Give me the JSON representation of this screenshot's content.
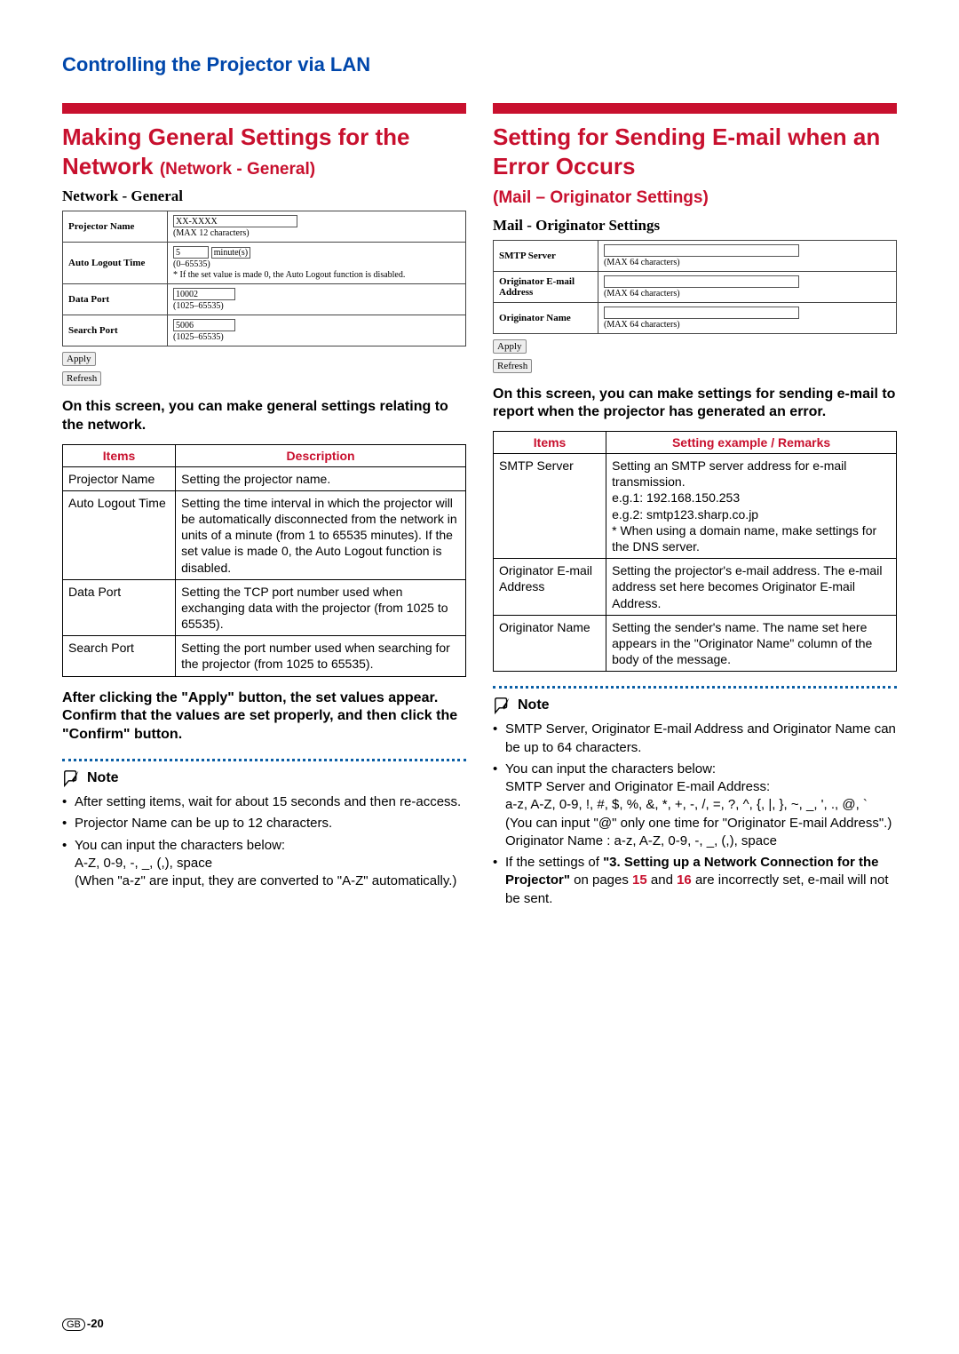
{
  "page_title": "Controlling the Projector via LAN",
  "left": {
    "heading_main": "Making General Settings for the Network ",
    "heading_sub": "(Network - General)",
    "ss_title": "Network - General",
    "form": {
      "projector_name": {
        "label": "Projector Name",
        "value": "XX-XXXX",
        "hint": "(MAX 12 characters)"
      },
      "auto_logout": {
        "label": "Auto Logout Time",
        "value": "5",
        "unit": "minute(s)",
        "hint1": "(0–65535)",
        "hint2": "* If the set value is made 0, the Auto Logout function is disabled."
      },
      "data_port": {
        "label": "Data Port",
        "value": "10002",
        "hint": "(1025–65535)"
      },
      "search_port": {
        "label": "Search Port",
        "value": "5006",
        "hint": "(1025–65535)"
      }
    },
    "apply_btn": "Apply",
    "refresh_btn": "Refresh",
    "intro": "On this screen, you can make general settings relating to the network.",
    "table_headers": {
      "items": "Items",
      "desc": "Description"
    },
    "rows": [
      {
        "item": "Projector Name",
        "desc": "Setting the projector name."
      },
      {
        "item": "Auto Logout Time",
        "desc": "Setting the time interval in which the projector will be automatically disconnected from the network in units of a minute (from 1 to 65535 minutes). If the set value is made 0, the Auto Logout function is disabled."
      },
      {
        "item": "Data Port",
        "desc": "Setting the TCP port number used when exchanging data with the projector (from 1025 to 65535)."
      },
      {
        "item": "Search Port",
        "desc": "Setting the port number used when searching for the projector (from 1025 to 65535)."
      }
    ],
    "after_apply": "After clicking the \"Apply\" button, the set values appear. Confirm that the values are set properly, and then click the \"Confirm\" button.",
    "note_label": "Note",
    "notes": [
      "After setting items, wait for about 15 seconds and then re-access.",
      "Projector Name can be up to 12 characters.",
      "You can input the characters below:\nA-Z, 0-9, -, _, (,), space\n(When \"a-z\" are input, they are converted to \"A-Z\" automatically.)"
    ]
  },
  "right": {
    "heading_main": "Setting for Sending E-mail when an Error Occurs",
    "heading_sub": "(Mail – Originator Settings)",
    "ss_title": "Mail - Originator Settings",
    "form": {
      "smtp": {
        "label": "SMTP Server",
        "hint": "(MAX 64 characters)"
      },
      "oemail": {
        "label": "Originator E-mail Address",
        "hint": "(MAX 64 characters)"
      },
      "oname": {
        "label": "Originator Name",
        "hint": "(MAX 64 characters)"
      }
    },
    "apply_btn": "Apply",
    "refresh_btn": "Refresh",
    "intro": "On this screen, you can make settings for sending e-mail to report when the projector has generated an error.",
    "table_headers": {
      "items": "Items",
      "desc": "Setting example / Remarks"
    },
    "rows": [
      {
        "item": "SMTP Server",
        "desc": "Setting an SMTP server address for e-mail transmission.\ne.g.1: 192.168.150.253\ne.g.2: smtp123.sharp.co.jp\n* When using a domain name, make settings for the DNS server."
      },
      {
        "item": "Originator E-mail Address",
        "desc": "Setting the projector's e-mail address. The e-mail address set here becomes Originator E-mail Address."
      },
      {
        "item": "Originator Name",
        "desc": "Setting the sender's name.  The name set here appears in the \"Originator Name\" column of the body of the message."
      }
    ],
    "note_label": "Note",
    "notes_plain": [
      "SMTP Server, Originator E-mail Address and Originator Name can be up to 64 characters.",
      "You can input the characters below:\nSMTP Server and Originator E-mail Address:\na-z, A-Z, 0-9, !, #, $, %, &, *, +, -, /, =, ?, ^, {, |, }, ~, _, ', ., @, `\n(You can input \"@\" only one time for \"Originator E-mail Address\".)\nOriginator Name : a-z, A-Z, 0-9, -, _, (,), space"
    ],
    "note3_pre": "If the settings of ",
    "note3_bold": "\"3. Setting up a Network Connection for the Projector\"",
    "note3_mid": " on pages ",
    "note3_p1": "15",
    "note3_and": " and ",
    "note3_p2": "16",
    "note3_post": " are incorrectly set, e-mail will not be sent."
  },
  "footer": {
    "gb": "GB",
    "page": "-20"
  }
}
